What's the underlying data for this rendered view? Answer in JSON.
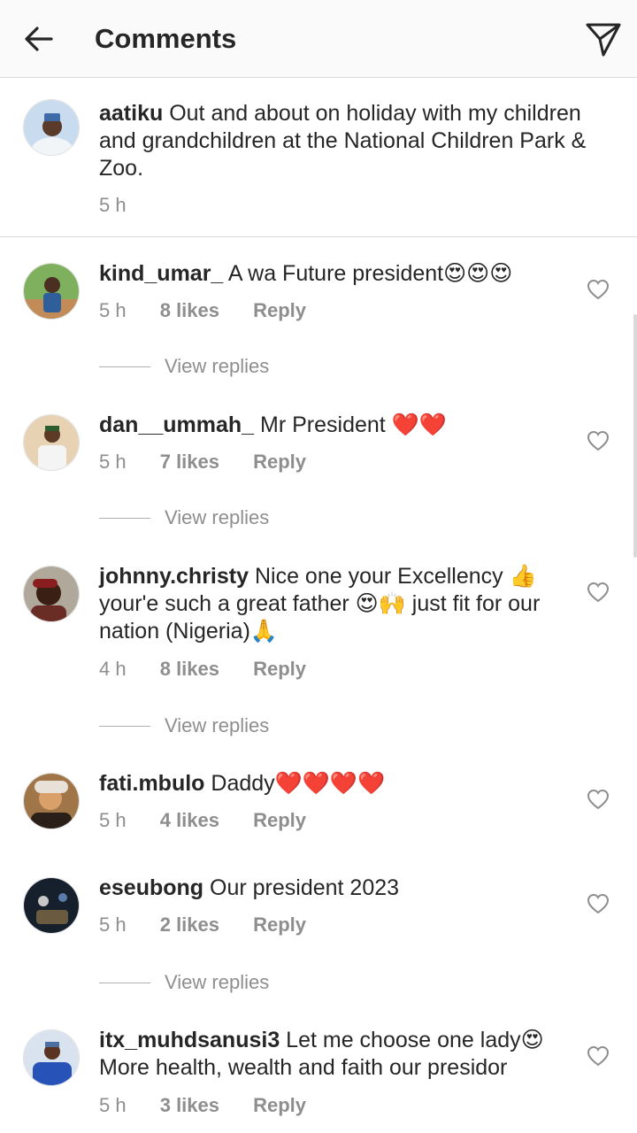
{
  "header": {
    "title": "Comments"
  },
  "caption": {
    "username": "aatiku",
    "text": " Out and about on holiday with my children and grandchildren at the National Children Park & Zoo.",
    "time": "5 h"
  },
  "comments": [
    {
      "username": "kind_umar_",
      "text": " A wa Future  president😍😍😍",
      "time": "5 h",
      "likes": "8 likes",
      "reply": "Reply",
      "view_replies": "View replies",
      "avatar_color": "#4c8a3c"
    },
    {
      "username": "dan__ummah_",
      "text": " Mr President ❤️❤️",
      "time": "5 h",
      "likes": "7 likes",
      "reply": "Reply",
      "view_replies": "View replies",
      "avatar_color": "#c9a27a"
    },
    {
      "username": "johnny.christy",
      "text": " Nice one your Excellency 👍 your'e such a great father 😍🙌 just fit for our nation (Nigeria)🙏",
      "time": "4 h",
      "likes": "8 likes",
      "reply": "Reply",
      "view_replies": "View replies",
      "avatar_color": "#7a3a2a"
    },
    {
      "username": "fati.mbulo",
      "text": " Daddy❤️❤️❤️❤️",
      "time": "5 h",
      "likes": "4 likes",
      "reply": "Reply",
      "avatar_color": "#c48a5a"
    },
    {
      "username": "eseubong",
      "text": " Our president 2023",
      "time": "5 h",
      "likes": "2 likes",
      "reply": "Reply",
      "view_replies": "View replies",
      "avatar_color": "#1d2a3a"
    },
    {
      "username": "itx_muhdsanusi3",
      "text": " Let me choose one lady😍 More health, wealth and faith our presidor",
      "time": "5 h",
      "likes": "3 likes",
      "reply": "Reply",
      "avatar_color": "#2a5ab0"
    }
  ],
  "colors": {
    "text": "#262626",
    "muted": "#8e8e8e",
    "divider": "#dbdbdb",
    "header_bg": "#fafafa"
  },
  "icons": {
    "back": "arrow-left-icon",
    "send": "paper-plane-icon",
    "like": "heart-outline-icon"
  }
}
